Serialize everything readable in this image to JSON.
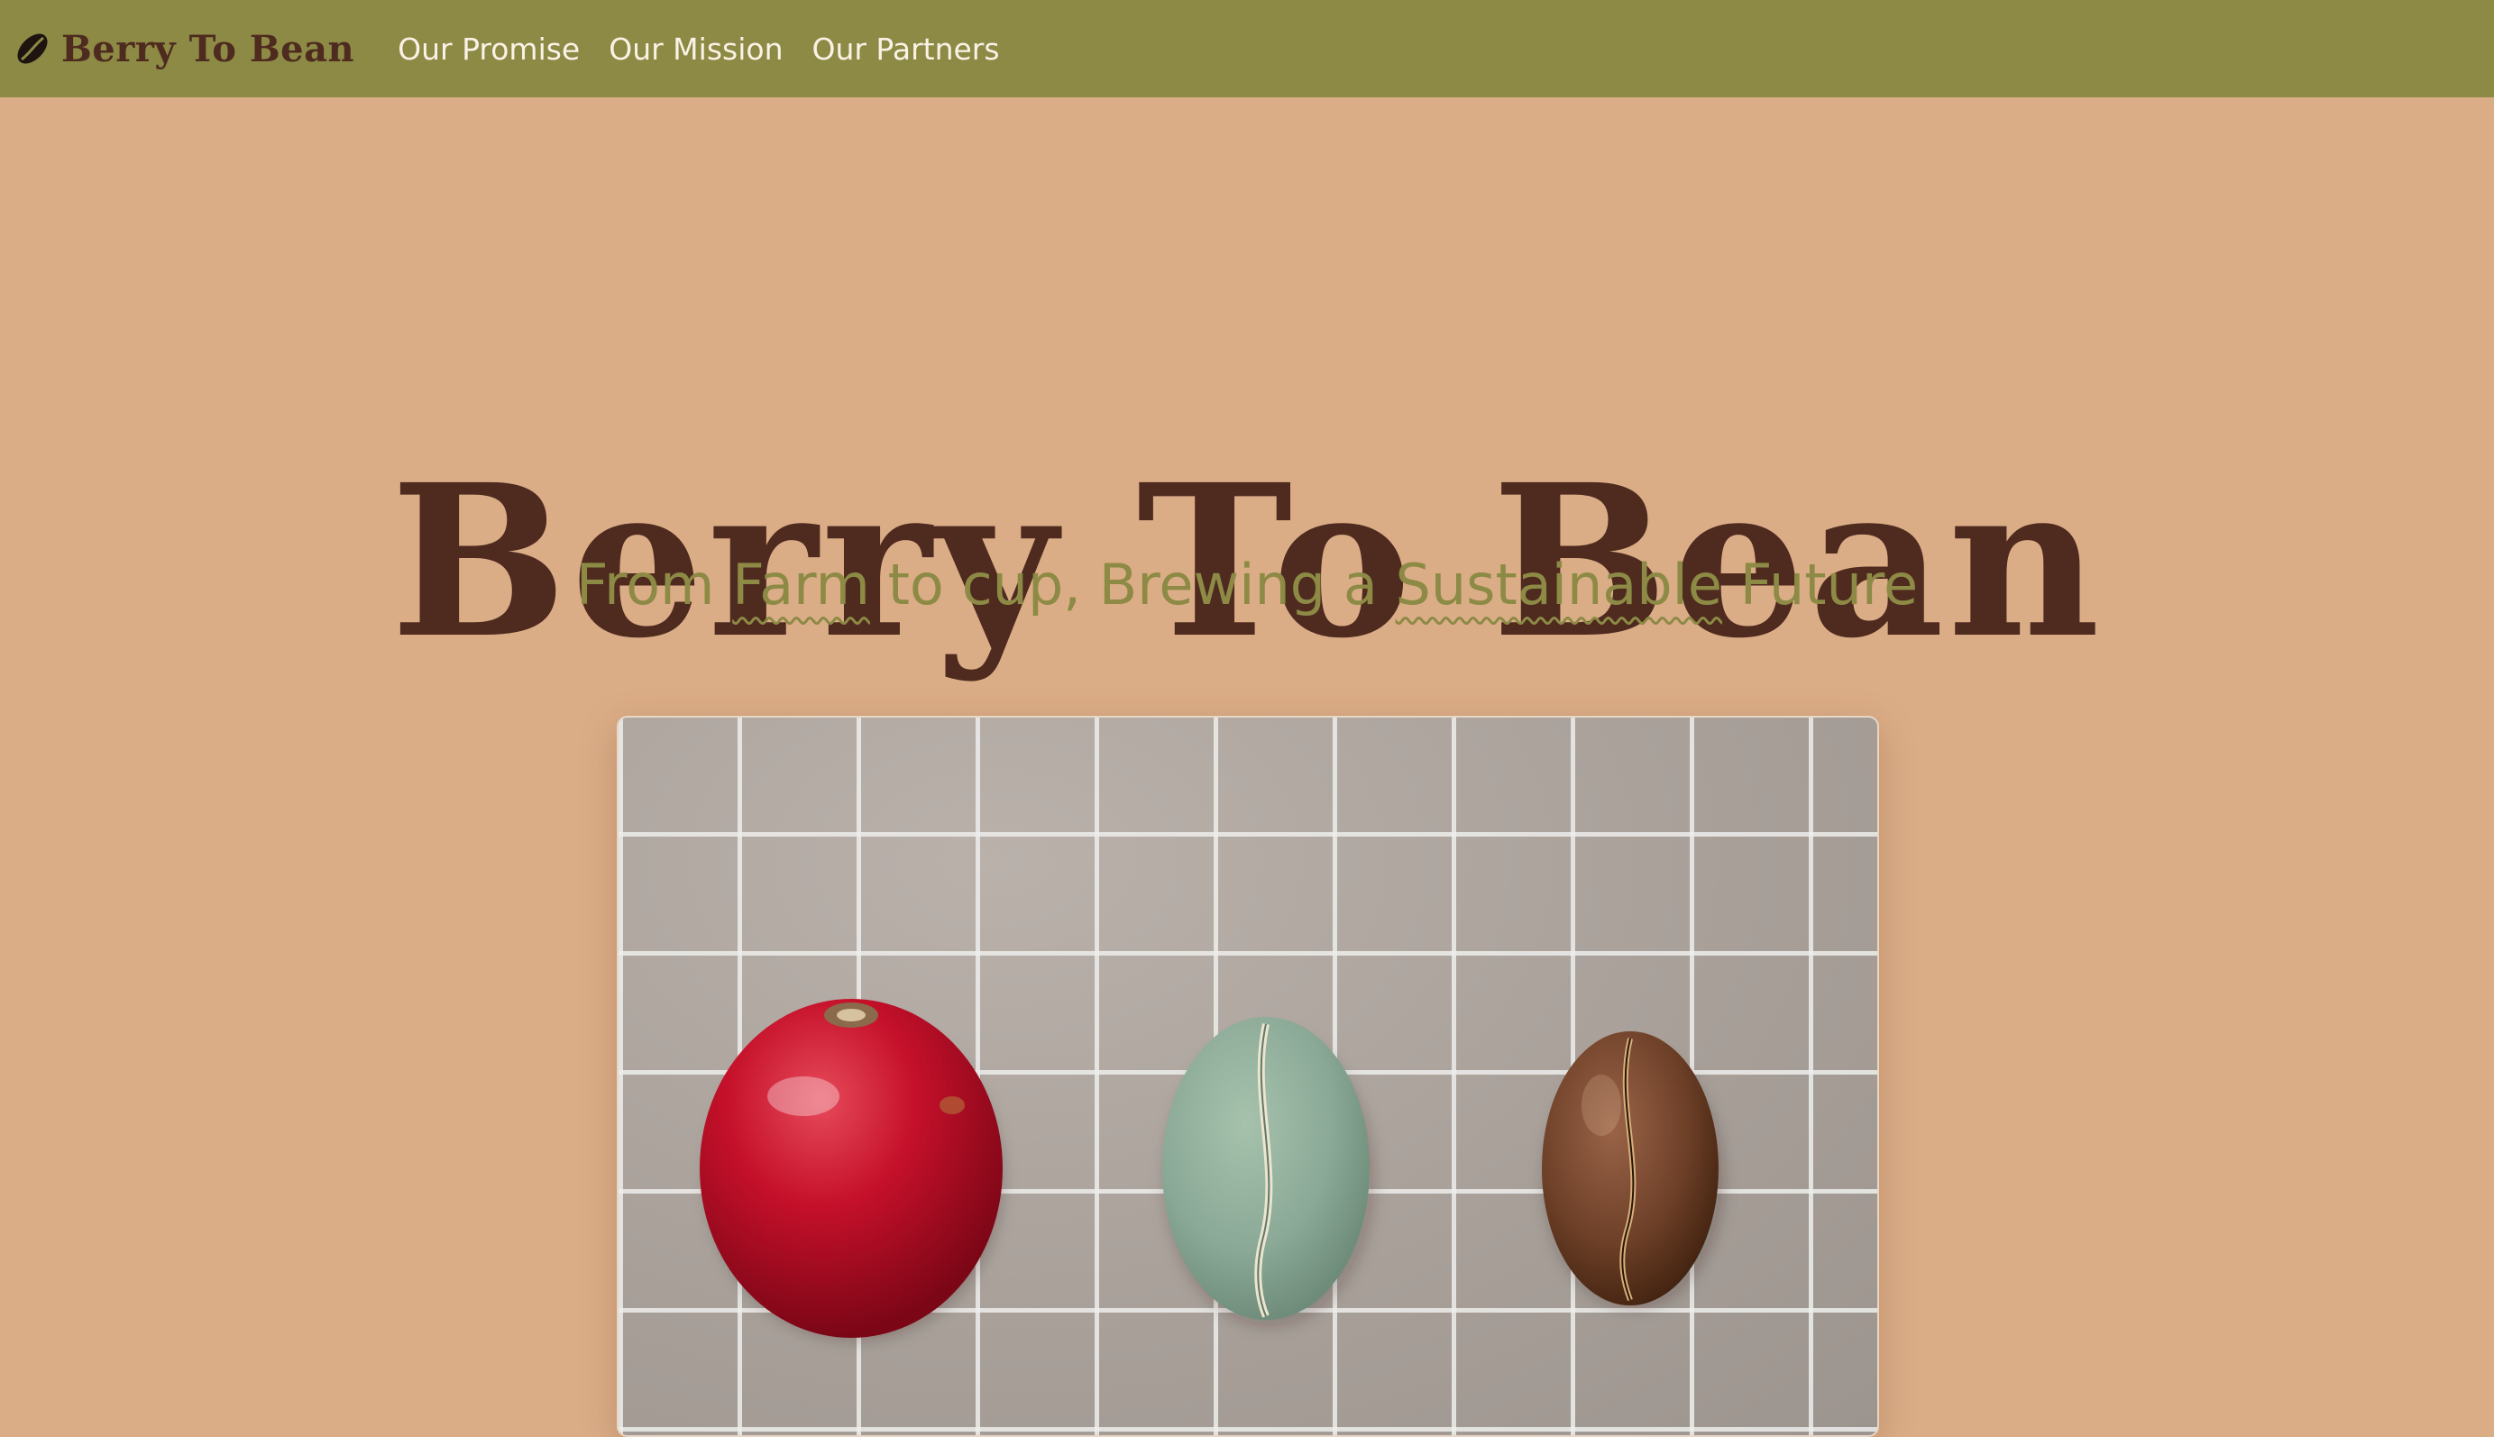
{
  "nav": {
    "brand": "Berry To Bean",
    "brand_icon": "coffee-bean-icon",
    "links": [
      "Our Promise",
      "Our Mission",
      "Our Partners"
    ]
  },
  "hero": {
    "title": "Berry To Bean",
    "subtitle": {
      "part1": "From ",
      "highlight1": "Farm",
      "part2": " to cup, Brewing a ",
      "highlight2": "Sustainable",
      "part3": " Future"
    },
    "image_subjects": [
      "coffee cherry",
      "green coffee bean",
      "roasted coffee bean"
    ]
  },
  "colors": {
    "page_background": "#dbad87",
    "nav_background": "#8c8a45",
    "title_brown": "#4e2a1f",
    "subtitle_olive": "#8c8a45",
    "nav_link": "#fbf2e6"
  }
}
